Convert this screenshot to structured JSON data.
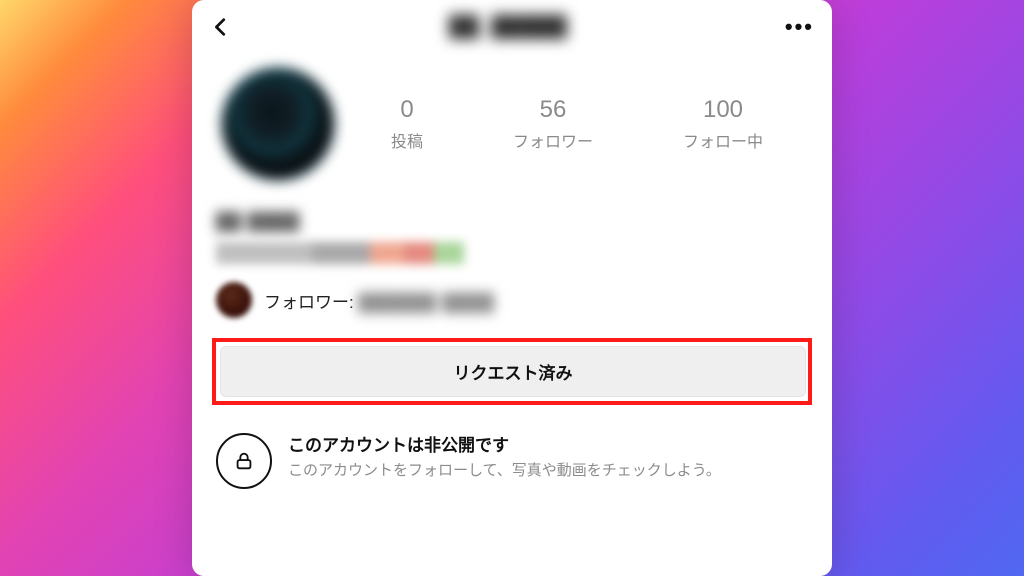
{
  "header": {
    "username_masked": "██_█████",
    "back_aria": "戻る",
    "more_aria": "その他"
  },
  "profile": {
    "display_name_masked": "██ ████",
    "bio_masked": "██████ ██ ██"
  },
  "stats": {
    "posts": {
      "value": "0",
      "label": "投稿"
    },
    "followers": {
      "value": "56",
      "label": "フォロワー"
    },
    "following": {
      "value": "100",
      "label": "フォロー中"
    }
  },
  "followers_line": {
    "prefix": "フォロワー:",
    "names_masked": "██████ ████"
  },
  "actions": {
    "request_button": "リクエスト済み"
  },
  "private": {
    "title": "このアカウントは非公開です",
    "subtitle": "このアカウントをフォローして、写真や動画をチェックしよう。"
  },
  "colors": {
    "highlight_box": "#ff1a1a",
    "button_bg": "#efefef"
  }
}
